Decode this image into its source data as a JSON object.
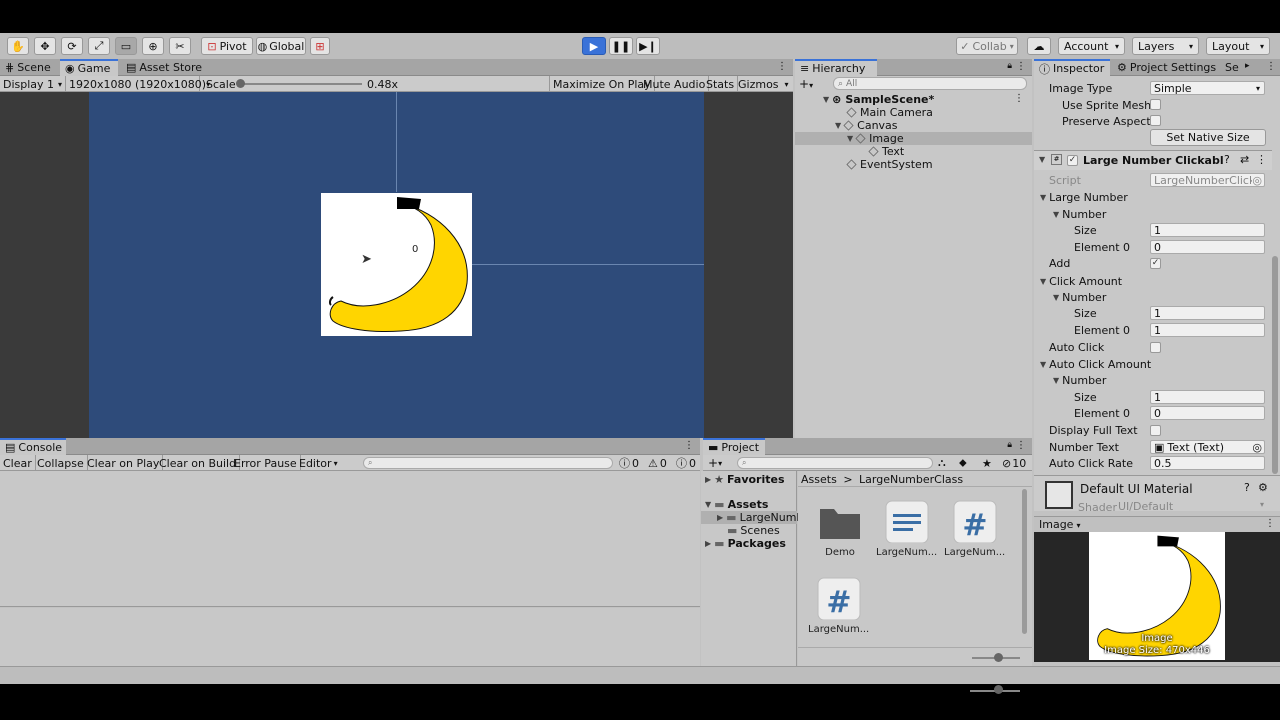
{
  "toolbar": {
    "pivot_label": "Pivot",
    "global_label": "Global",
    "collab_label": "Collab",
    "account_label": "Account",
    "layers_label": "Layers",
    "layout_label": "Layout"
  },
  "scene_tabs": {
    "scene": "Scene",
    "game": "Game",
    "asset_store": "Asset Store"
  },
  "game_bar": {
    "display": "Display 1",
    "resolution": "1920x1080 (1920x1080)",
    "scale_label": "Scale",
    "scale_value": "0.48x",
    "scale_fraction": 0.0,
    "maximize": "Maximize On Play",
    "mute": "Mute Audio",
    "stats": "Stats",
    "gizmos": "Gizmos"
  },
  "game_view": {
    "number_text": "0",
    "background_color": "#2e4b7a"
  },
  "hierarchy": {
    "tab": "Hierarchy",
    "search_placeholder": "All",
    "items": [
      {
        "label": "SampleScene*"
      },
      {
        "label": "Main Camera"
      },
      {
        "label": "Canvas"
      },
      {
        "label": "Image"
      },
      {
        "label": "Text"
      },
      {
        "label": "EventSystem"
      }
    ]
  },
  "inspector": {
    "tab": "Inspector",
    "tab2": "Project Settings",
    "tab3": "Se",
    "image_type_label": "Image Type",
    "image_type_value": "Simple",
    "use_sprite_mesh": "Use Sprite Mesh",
    "preserve_aspect": "Preserve Aspect",
    "set_native_size": "Set Native Size",
    "component_title": "Large Number Clickable Ol",
    "script_label": "Script",
    "script_value": "LargeNumberClick",
    "large_number": "Large Number",
    "number": "Number",
    "size": "Size",
    "element0": "Element 0",
    "large_size": "1",
    "large_el0": "0",
    "add": "Add",
    "click_amount": "Click Amount",
    "click_size": "1",
    "click_el0": "1",
    "auto_click": "Auto Click",
    "auto_click_amount": "Auto Click Amount",
    "auto_size": "1",
    "auto_el0": "0",
    "display_full_text": "Display Full Text",
    "number_text_label": "Number Text",
    "number_text_value": "Text (Text)",
    "auto_click_rate_label": "Auto Click Rate",
    "auto_click_rate_value": "0.5",
    "material_name": "Default UI Material",
    "shader_label": "Shader",
    "shader_value": "UI/Default"
  },
  "preview": {
    "header": "Image",
    "caption1": "Image",
    "caption2": "Image Size: 470x446"
  },
  "console": {
    "tab": "Console",
    "clear": "Clear",
    "collapse": "Collapse",
    "clear_on_play": "Clear on Play",
    "clear_on_build": "Clear on Build",
    "error_pause": "Error Pause",
    "editor": "Editor",
    "count_logs": "0",
    "count_warnings": "0",
    "count_errors": "0"
  },
  "project": {
    "tab": "Project",
    "hidden_count": "10",
    "favorites": "Favorites",
    "assets": "Assets",
    "folder_largenumber": "LargeNumb",
    "folder_scenes": "Scenes",
    "packages": "Packages",
    "breadcrumb_root": "Assets",
    "breadcrumb_sep": ">",
    "breadcrumb_current": "LargeNumberClass",
    "files": [
      {
        "label": "Demo",
        "icon": "folder-icon"
      },
      {
        "label": "LargeNum...",
        "icon": "text-file-icon"
      },
      {
        "label": "LargeNum...",
        "icon": "script-icon"
      },
      {
        "label": "LargeNum...",
        "icon": "script-icon"
      }
    ]
  },
  "colors": {
    "accent": "#3a72d8",
    "banana": "#ffd500",
    "panel": "#c2c2c2"
  }
}
